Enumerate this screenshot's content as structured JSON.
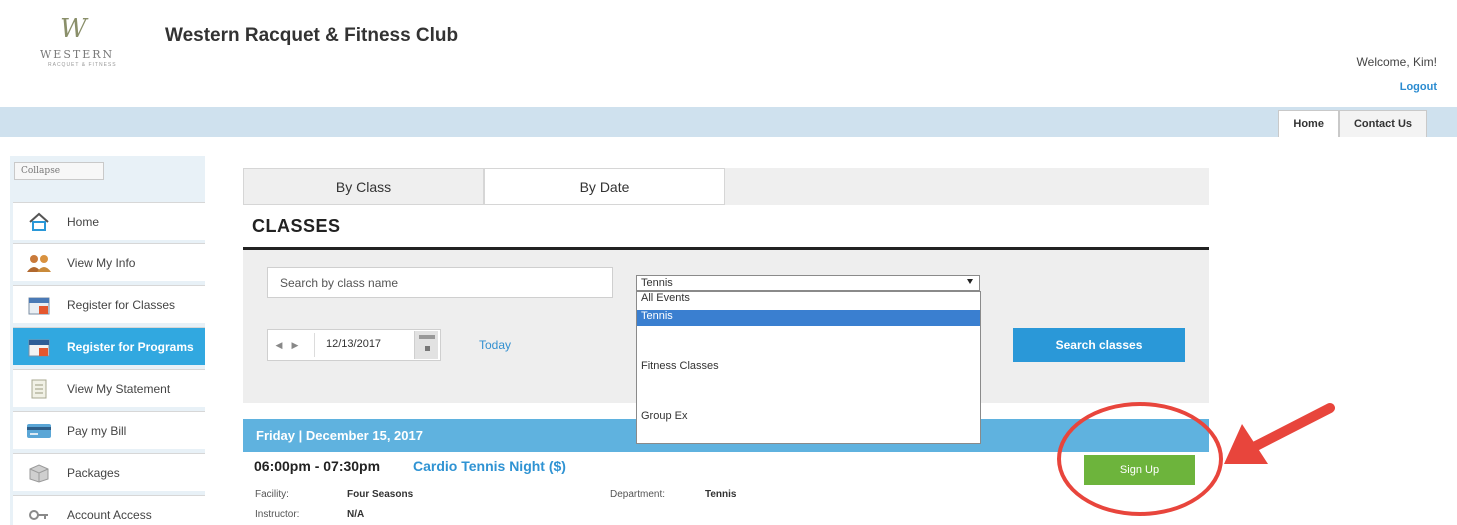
{
  "header": {
    "logo_mark": "W",
    "logo_word": "WESTERN",
    "logo_sub": "RACQUET & FITNESS",
    "club_name": "Western Racquet & Fitness Club",
    "welcome": "Welcome, Kim!",
    "logout": "Logout"
  },
  "top_tabs": [
    "Home",
    "Contact Us"
  ],
  "sidebar": {
    "collapse_label": "Collapse",
    "items": [
      {
        "label": "Home",
        "icon": "house-icon"
      },
      {
        "label": "View My Info",
        "icon": "people-icon"
      },
      {
        "label": "Register for Classes",
        "icon": "calendar-icon"
      },
      {
        "label": "Register for Programs",
        "icon": "calendar-icon",
        "active": true
      },
      {
        "label": "View My Statement",
        "icon": "document-icon"
      },
      {
        "label": "Pay my Bill",
        "icon": "credit-card-icon"
      },
      {
        "label": "Packages",
        "icon": "box-icon"
      },
      {
        "label": "Account Access",
        "icon": "key-icon"
      }
    ]
  },
  "main": {
    "tabs": [
      "By Class",
      "By Date"
    ],
    "active_tab": "By Date",
    "heading": "CLASSES",
    "search": {
      "placeholder": "Search by class name",
      "button_label": "Search classes"
    },
    "filter": {
      "selected": "Tennis",
      "options": [
        "All Events",
        "Tennis",
        "Fitness Classes",
        "Group Ex"
      ]
    },
    "date": {
      "prev_glyph": "◀",
      "next_glyph": "▶",
      "value": "12/13/2017",
      "today_label": "Today"
    },
    "day_header": "Friday | December 15, 2017",
    "class": {
      "time": "06:00pm - 07:30pm",
      "name": "Cardio Tennis Night ($)",
      "signup_label": "Sign Up",
      "facility_label": "Facility:",
      "facility": "Four Seasons",
      "department_label": "Department:",
      "department": "Tennis",
      "instructor_label": "Instructor:",
      "instructor": "N/A"
    }
  },
  "colors": {
    "accent_blue": "#2a98d8",
    "sidebar_active": "#31a8e0",
    "signup_green": "#6db43c",
    "annotation_red": "#e8453c"
  }
}
